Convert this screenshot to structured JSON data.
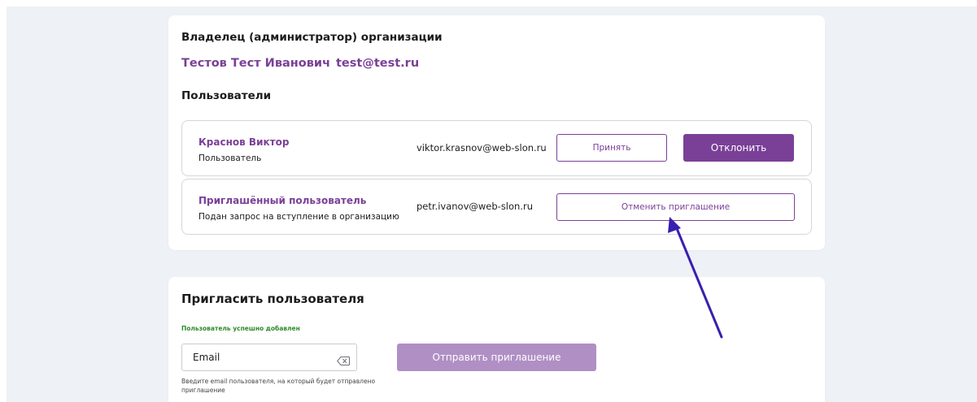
{
  "owner": {
    "heading": "Владелец (администратор) организации",
    "name": "Тестов Тест Иванович",
    "email": "test@test.ru"
  },
  "users": {
    "heading": "Пользователи",
    "rows": [
      {
        "name": "Краснов Виктор",
        "role": "Пользователь",
        "email": "viktor.krasnov@web-slon.ru",
        "accept_label": "Принять",
        "reject_label": "Отклонить"
      },
      {
        "name": "Приглашённый пользователь",
        "role": "Подан запрос на вступление в организацию",
        "email": "petr.ivanov@web-slon.ru",
        "cancel_label": "Отменить приглашение"
      }
    ]
  },
  "invite": {
    "heading": "Пригласить пользователя",
    "success": "Пользователь успешно добавлен",
    "email_value": "Email",
    "hint": "Введите email пользователя, на который будет отправлено приглашение",
    "send_label": "Отправить приглашение"
  },
  "icons": {
    "clear": "backspace-clear-icon",
    "annotation": "arrow-annotation-icon"
  },
  "colors": {
    "accent": "#7a4097",
    "accent_disabled": "#b08fc5",
    "success": "#2f8a2a",
    "page_bg": "#eef1f5",
    "annotation_arrow": "#3a1fb0"
  }
}
